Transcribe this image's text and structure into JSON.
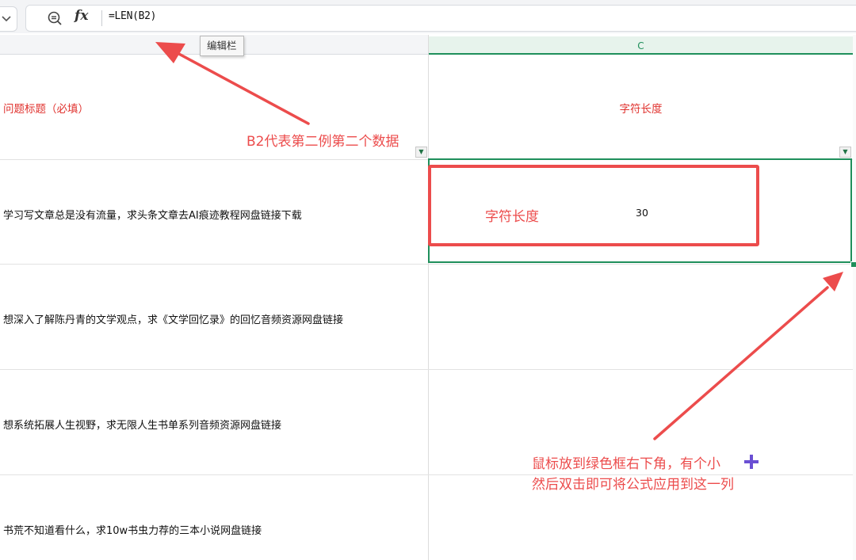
{
  "formula_bar": {
    "formula": "=LEN(B2)",
    "fx_label": "fx",
    "tooltip": "编辑栏"
  },
  "columns": {
    "c_label": "C"
  },
  "headers": {
    "b_title": "问题标题（必填）",
    "c_title": "字符长度"
  },
  "rows": [
    {
      "b": "学习写文章总是没有流量，求头条文章去AI痕迹教程网盘链接下载",
      "c": "30"
    },
    {
      "b": "想深入了解陈丹青的文学观点，求《文学回忆录》的回忆音频资源网盘链接",
      "c": ""
    },
    {
      "b": "想系统拓展人生视野，求无限人生书单系列音频资源网盘链接",
      "c": ""
    },
    {
      "b": "书荒不知道看什么，求10w书虫力荐的三本小说网盘链接",
      "c": ""
    }
  ],
  "annotations": {
    "b2_note": "B2代表第二例第二个数据",
    "red_box_label": "字符长度",
    "hint_line1": "鼠标放到绿色框右下角，有个小",
    "hint_line2": "然后双击即可将公式应用到这一列"
  },
  "icons": {
    "chevron": "chevron-down-icon",
    "zoom": "zoom-formula-icon",
    "fx": "fx-icon",
    "filter": "filter-dropdown-icon",
    "plus": "plus-icon"
  },
  "colors": {
    "selection_green": "#1f8f5b",
    "annotation_red": "#ec4c4c",
    "header_red": "#e0332f",
    "plus_purple": "#6a4fd3"
  }
}
